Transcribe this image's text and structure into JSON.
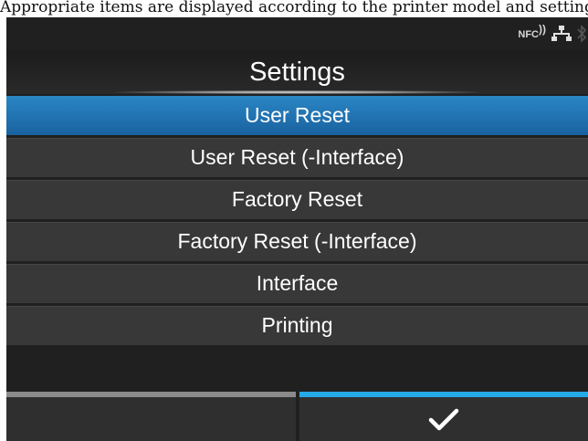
{
  "caption": "Appropriate items are displayed according to the printer model and settings.",
  "status": {
    "nfc_label": "NFC",
    "icons": [
      "nfc-icon",
      "network-icon",
      "bluetooth-icon"
    ]
  },
  "header": {
    "title": "Settings"
  },
  "menu": {
    "items": [
      {
        "label": "User Reset",
        "selected": true
      },
      {
        "label": "User Reset (-Interface)",
        "selected": false
      },
      {
        "label": "Factory Reset",
        "selected": false
      },
      {
        "label": "Factory Reset (-Interface)",
        "selected": false
      },
      {
        "label": "Interface",
        "selected": false
      },
      {
        "label": "Printing",
        "selected": false
      }
    ]
  },
  "footer": {
    "left_button": "",
    "right_button_icon": "check-icon"
  },
  "colors": {
    "selected": "#1a6fb0",
    "confirm_accent": "#26a9e8",
    "background": "#202020"
  }
}
